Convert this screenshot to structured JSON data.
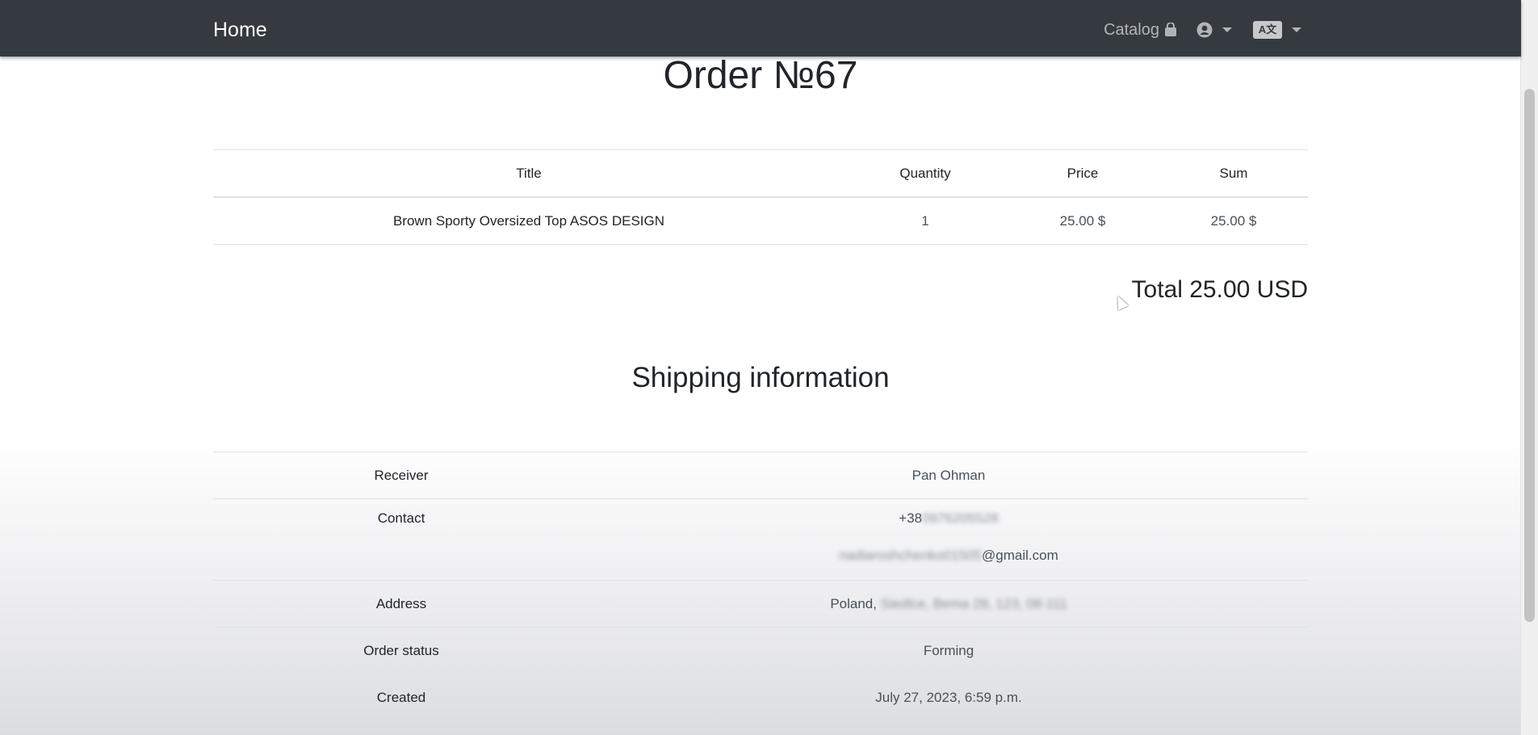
{
  "navbar": {
    "brand": "Home",
    "catalog_label": "Catalog",
    "catalog_icon": "shopping-bag-icon",
    "user_icon": "user-circle-icon",
    "language_icon": "language-icon",
    "language_glyph": "A文"
  },
  "order": {
    "title": "Order №67",
    "table": {
      "headers": [
        "Title",
        "Quantity",
        "Price",
        "Sum"
      ],
      "rows": [
        [
          "Brown Sporty Oversized Top ASOS DESIGN",
          "1",
          "25.00 $",
          "25.00 $"
        ]
      ]
    },
    "total": "Total 25.00 USD"
  },
  "shipping": {
    "title": "Shipping information",
    "receiver_label": "Receiver",
    "receiver_value": "Pan Ohman",
    "contact_label": "Contact",
    "contact_phone_prefix": "+38",
    "contact_phone_blurred": "0976205528",
    "contact_email_blurred": "nadiaroshchenko01505",
    "contact_email_domain": "@gmail.com",
    "address_label": "Address",
    "address_country": "Poland,",
    "address_blurred": "Siedlce, Bema 28, 123, 08-111",
    "status_label": "Order status",
    "status_value": "Forming",
    "created_label": "Created",
    "created_value": "July 27, 2023, 6:59 p.m."
  }
}
